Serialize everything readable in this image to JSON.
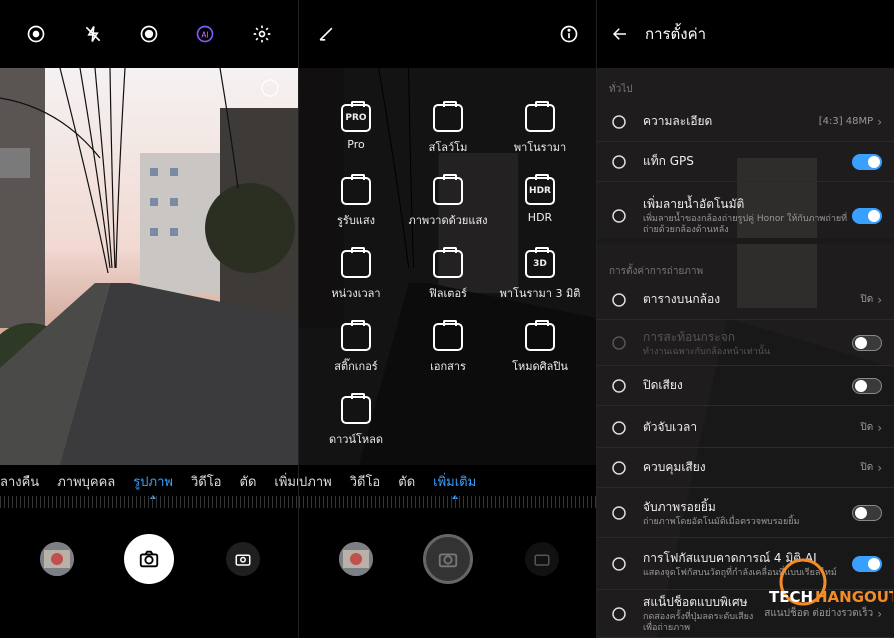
{
  "panel1": {
    "modes": [
      "ลางคืน",
      "ภาพบุคคล",
      "รูปภาพ",
      "วิดีโอ",
      "ตัด",
      "เพิ่มเติ"
    ],
    "active_mode_index": 2
  },
  "panel2": {
    "modes": [
      "ปภาพ",
      "วิดีโอ",
      "ตัด",
      "เพิ่มเติม"
    ],
    "active_mode_index": 3,
    "grid": [
      {
        "label": "Pro",
        "icon_text": "PRO",
        "icon": "pro-icon"
      },
      {
        "label": "สโลว์โม",
        "icon_text": "",
        "icon": "slowmo-icon"
      },
      {
        "label": "พาโนรามา",
        "icon_text": "",
        "icon": "panorama-icon"
      },
      {
        "label": "รูรับแสง",
        "icon_text": "",
        "icon": "aperture-icon"
      },
      {
        "label": "ภาพวาดด้วยแสง",
        "icon_text": "",
        "icon": "light-painting-icon"
      },
      {
        "label": "HDR",
        "icon_text": "HDR",
        "icon": "hdr-icon"
      },
      {
        "label": "หน่วงเวลา",
        "icon_text": "",
        "icon": "timelapse-icon"
      },
      {
        "label": "ฟิลเตอร์",
        "icon_text": "",
        "icon": "filter-icon"
      },
      {
        "label": "พาโนรามา 3 มิติ",
        "icon_text": "3D",
        "icon": "panorama-3d-icon"
      },
      {
        "label": "สติ๊กเกอร์",
        "icon_text": "",
        "icon": "sticker-icon"
      },
      {
        "label": "เอกสาร",
        "icon_text": "",
        "icon": "document-icon"
      },
      {
        "label": "โหมดศิลปิน",
        "icon_text": "",
        "icon": "artist-icon"
      },
      {
        "label": "ดาวน์โหลด",
        "icon_text": "",
        "icon": "download-icon"
      }
    ]
  },
  "settings": {
    "title": "การตั้งค่า",
    "section_general": "ทั่วไป",
    "section_capture": "การตั้งค่าการถ่ายภาพ",
    "rows": [
      {
        "title": "ความละเอียด",
        "subtitle": "",
        "value": "[4:3] 48MP",
        "control": "chevron",
        "icon": "resolution-icon"
      },
      {
        "title": "แท็ก GPS",
        "subtitle": "",
        "value": "",
        "control": "toggle-on",
        "icon": "location-icon"
      },
      {
        "title": "เพิ่มลายน้ำอัตโนมัติ",
        "subtitle": "เพิ่มลายน้ำของกล้องถ่ายรูปคู่ Honor ให้กับภาพถ่ายที่ถ่ายด้วยกล้องด้านหลัง",
        "value": "",
        "control": "toggle-on",
        "icon": "stamp-icon"
      },
      {
        "title": "ตารางบนกล้อง",
        "subtitle": "",
        "value": "ปิด",
        "control": "chevron",
        "icon": "grid-icon"
      },
      {
        "title": "การสะท้อนกระจก",
        "subtitle": "ทำงานเฉพาะกับกล้องหน้าเท่านั้น",
        "value": "",
        "control": "toggle-off-disabled",
        "icon": "mirror-icon"
      },
      {
        "title": "ปิดเสียง",
        "subtitle": "",
        "value": "",
        "control": "toggle-off",
        "icon": "mute-icon"
      },
      {
        "title": "ตัวจับเวลา",
        "subtitle": "",
        "value": "ปิด",
        "control": "chevron",
        "icon": "timer-icon"
      },
      {
        "title": "ควบคุมเสียง",
        "subtitle": "",
        "value": "ปิด",
        "control": "chevron",
        "icon": "audio-control-icon"
      },
      {
        "title": "จับภาพรอยยิ้ม",
        "subtitle": "ถ่ายภาพโดยอัตโนมัติเมื่อตรวจพบรอยยิ้ม",
        "value": "",
        "control": "toggle-off",
        "icon": "smile-icon"
      },
      {
        "title": "การโฟกัสแบบคาดการณ์ 4 มิติ AI",
        "subtitle": "แสดงจุดโฟกัสบนวัตถุที่กำลังเคลื่อนที่แบบเรียลไทม์",
        "value": "",
        "control": "toggle-on",
        "icon": "focus-icon"
      },
      {
        "title": "สแน็ปช็อตแบบพิเศษ",
        "subtitle": "กดสองครั้งที่ปุ่มลดระดับเสียงเพื่อถ่ายภาพ",
        "value": "สแนปช็อต ต่อย่างรวดเร็ว",
        "control": "chevron",
        "icon": "snapshot-icon"
      }
    ]
  },
  "watermark": {
    "text": "TECHHANGOUT"
  },
  "colors": {
    "accent": "#3aa0ff",
    "toggle_on": "#3aa0ff",
    "orange": "#f28c28"
  }
}
